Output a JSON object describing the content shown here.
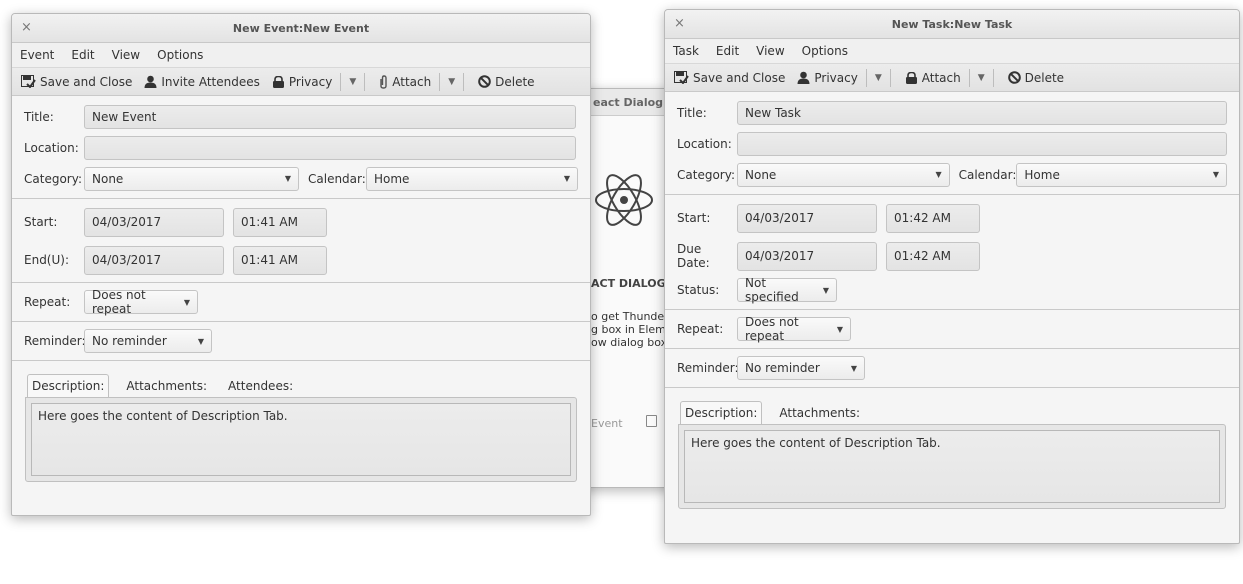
{
  "event": {
    "title": "New Event:New Event",
    "menu": [
      "Event",
      "Edit",
      "View",
      "Options"
    ],
    "toolbar": {
      "save_close": "Save and Close",
      "invite": "Invite Attendees",
      "privacy": "Privacy",
      "attach": "Attach",
      "delete": "Delete"
    },
    "labels": {
      "title": "Title:",
      "location": "Location:",
      "category": "Category:",
      "calendar": "Calendar:",
      "start": "Start:",
      "end": "End(U):",
      "repeat": "Repeat:",
      "reminder": "Reminder:"
    },
    "values": {
      "title": "New Event",
      "location": "",
      "category": "None",
      "calendar": "Home",
      "start_date": "04/03/2017",
      "start_time": "01:41 AM",
      "end_date": "04/03/2017",
      "end_time": "01:41 AM",
      "repeat": "Does not repeat",
      "reminder": "No reminder"
    },
    "tabs": [
      "Description:",
      "Attachments:",
      "Attendees:"
    ],
    "description": "Here goes the content of Description Tab."
  },
  "task": {
    "title": "New Task:New Task",
    "menu": [
      "Task",
      "Edit",
      "View",
      "Options"
    ],
    "toolbar": {
      "save_close": "Save and Close",
      "privacy": "Privacy",
      "attach": "Attach",
      "delete": "Delete"
    },
    "labels": {
      "title": "Title:",
      "location": "Location:",
      "category": "Category:",
      "calendar": "Calendar:",
      "start": "Start:",
      "due": "Due Date:",
      "status": "Status:",
      "repeat": "Repeat:",
      "reminder": "Reminder:"
    },
    "values": {
      "title": "New Task",
      "location": "",
      "category": "None",
      "calendar": "Home",
      "start_date": "04/03/2017",
      "start_time": "01:42 AM",
      "due_date": "04/03/2017",
      "due_time": "01:42 AM",
      "status": "Not specified",
      "repeat": "Does not repeat",
      "reminder": "No reminder"
    },
    "tabs": [
      "Description:",
      "Attachments:"
    ],
    "description": "Here goes the content of Description Tab."
  },
  "background_dialog": {
    "title_fragment": "eact Dialog Bo",
    "heading_fragment": "ACT DIALOG B",
    "body_lines": [
      "o get Thunderb",
      "g box in Eleme",
      "ow dialog box"
    ],
    "footer_fragment": "Event",
    "icon": "atom-icon"
  },
  "icons": {
    "save": "save-check-icon",
    "invite": "person-icon",
    "privacy": "lock-icon",
    "attach": "paperclip-icon",
    "delete": "no-entry-icon"
  }
}
